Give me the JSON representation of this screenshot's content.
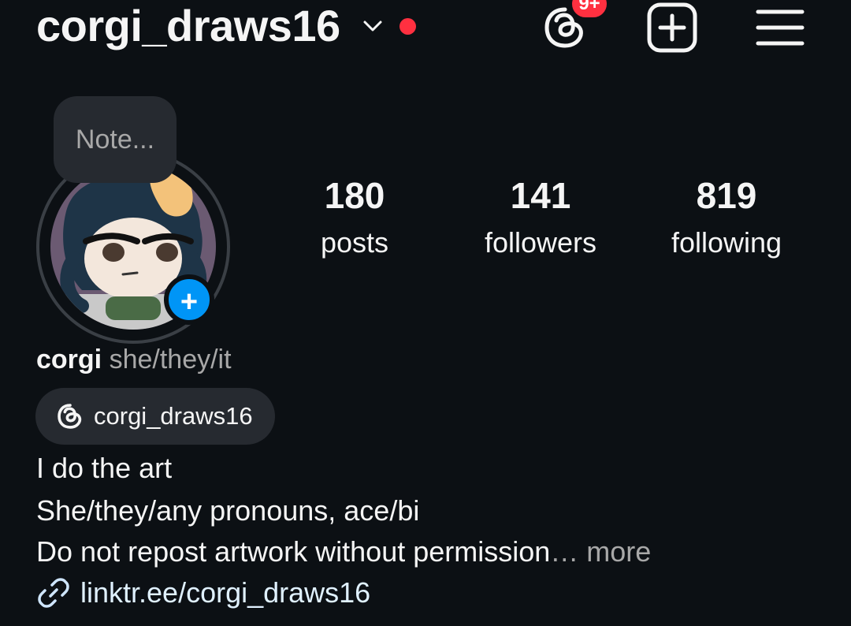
{
  "header": {
    "username": "corgi_draws16",
    "threads_badge": "9+",
    "unread_dot_color": "#ff3040",
    "badge_color": "#ff3040",
    "icons": [
      "chevron-down-icon",
      "threads-icon",
      "create-plus-icon",
      "menu-icon"
    ]
  },
  "profile": {
    "note_placeholder": "Note...",
    "add_story_symbol": "+",
    "stats": [
      {
        "value": "180",
        "label": "posts"
      },
      {
        "value": "141",
        "label": "followers"
      },
      {
        "value": "819",
        "label": "following"
      }
    ],
    "display_name": "corgi",
    "pronouns": "she/they/it",
    "threads_handle": "corgi_draws16",
    "bio": {
      "line1": "I do the art",
      "line2": "She/they/any pronouns, ace/bi",
      "line3": "Do not repost artwork without permission",
      "ellipsis": "…",
      "more": " more"
    },
    "link": "linktr.ee/corgi_draws16",
    "link_color": "#e0f1ff"
  }
}
